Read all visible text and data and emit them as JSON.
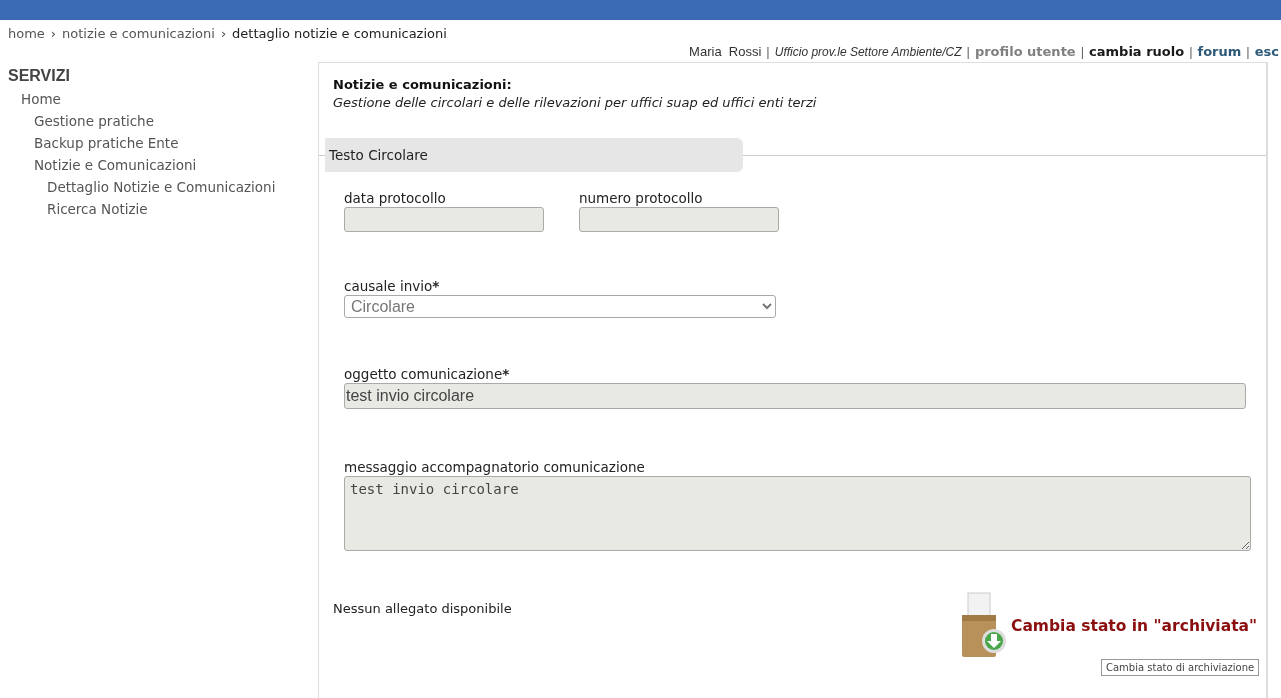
{
  "breadcrumb": [
    "home",
    "notizie e comunicazioni",
    "dettaglio notizie e comunicazioni"
  ],
  "breadcrumb_separator": "›",
  "user_bar": {
    "user": "Maria  Rossi",
    "office": "Ufficio prov.le Settore Ambiente/CZ",
    "separator": "|",
    "links": [
      {
        "label": "profilo utente",
        "color": "#808080"
      },
      {
        "label": "cambia ruolo",
        "color": "#1a1a1a"
      },
      {
        "label": "forum",
        "color": "#2e5a78"
      },
      {
        "label": "esc",
        "color": "#2e5a78"
      }
    ]
  },
  "sidebar": {
    "title": "SERVIZI",
    "items": [
      {
        "label": "Home",
        "children": [
          {
            "label": "Gestione pratiche"
          },
          {
            "label": "Backup pratiche Ente"
          },
          {
            "label": "Notizie e Comunicazioni",
            "children": [
              {
                "label": "Dettaglio Notizie e Comunicazioni"
              },
              {
                "label": "Ricerca Notizie"
              }
            ]
          }
        ]
      }
    ]
  },
  "page": {
    "title": "Notizie e comunicazioni:",
    "subtitle": "Gestione delle circolari e delle rilevazioni per uffici suap ed uffici enti terzi"
  },
  "section": {
    "title": "Testo Circolare"
  },
  "fields": [
    {
      "kind": "short",
      "label": "data protocollo",
      "required": false,
      "disabled": true
    },
    {
      "kind": "short",
      "label": "numero protocollo",
      "required": false,
      "disabled": true
    },
    {
      "kind": "select",
      "label": "causale invio",
      "required": true,
      "value": "Circolare",
      "disabled": false
    },
    {
      "kind": "text",
      "label": "oggetto comunicazione",
      "required": true,
      "value": "test invio circolare",
      "disabled": true
    },
    {
      "kind": "textarea",
      "label": "messaggio accompagnatorio comunicazione",
      "required": false,
      "value": "test invio circolare",
      "disabled": true
    }
  ],
  "required_mark": "*",
  "attachments": {
    "empty_text": "Nessun allegato disponibile"
  },
  "archive_button": {
    "label": "Cambia stato in \"archiviata\"",
    "tooltip": "Cambia stato di archiviazione"
  }
}
